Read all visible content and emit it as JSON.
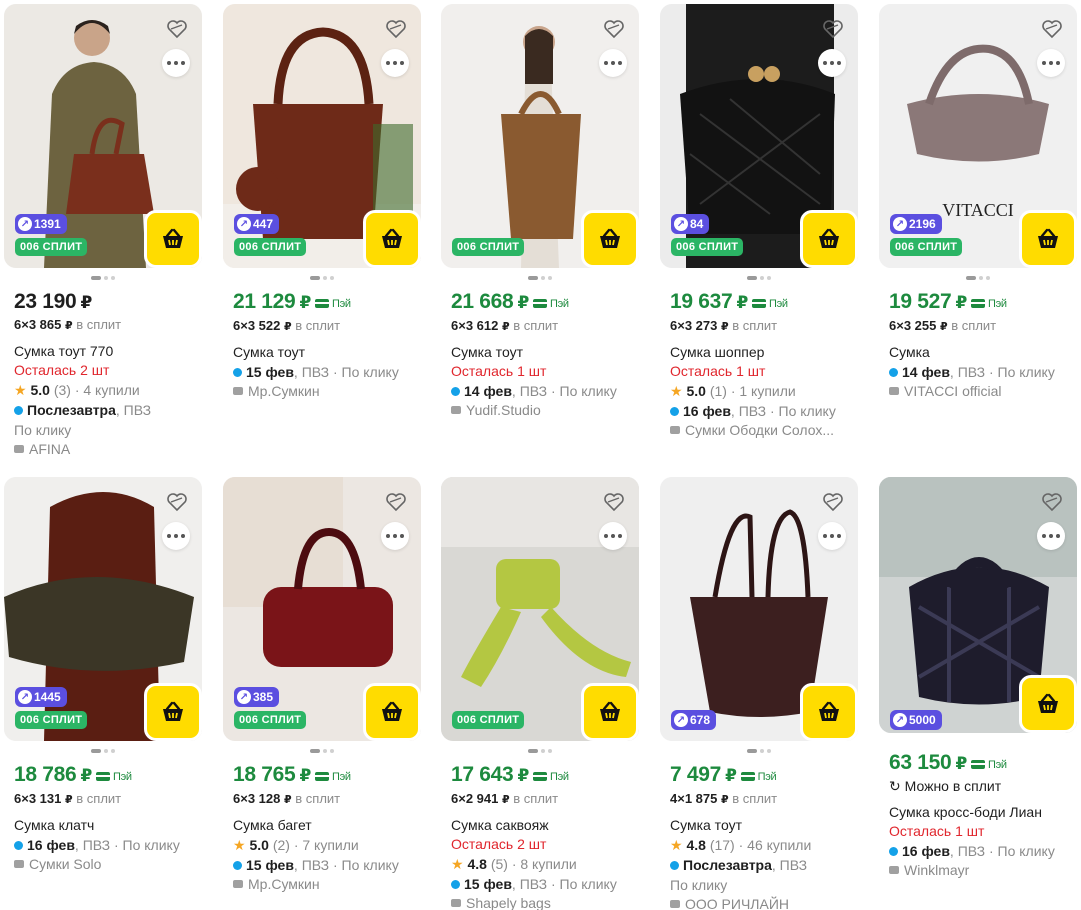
{
  "currency": "₽",
  "split_label": "006 СПЛИТ",
  "pay_label": "Пэй",
  "split_suffix": "в сплит",
  "products": [
    {
      "plus": "1391",
      "price": "23 190",
      "pay": false,
      "split": "6×3 865",
      "title": "Сумка тоут 770",
      "left": "Осталась 2 шт",
      "rating": "5.0",
      "reviews": "(3)",
      "bought": "· 4 купили",
      "delivery_date": "Послезавтра",
      "delivery_rest": ", ПВЗ",
      "delivery_rest2": "По клику",
      "shop": "AFINA"
    },
    {
      "plus": "447",
      "price": "21 129",
      "pay": true,
      "split": "6×3 522",
      "title": "Сумка тоут",
      "delivery_date": "15 фев",
      "delivery_rest": ", ПВЗ · По клику",
      "shop": "Мр.Сумкин"
    },
    {
      "plus": "",
      "price": "21 668",
      "pay": true,
      "split": "6×3 612",
      "title": "Сумка тоут",
      "left": "Осталась 1 шт",
      "delivery_date": "14 фев",
      "delivery_rest": ", ПВЗ · По клику",
      "shop": "Yudif.Studio"
    },
    {
      "plus": "84",
      "price": "19 637",
      "pay": true,
      "split": "6×3 273",
      "title": "Сумка шоппер",
      "left": "Осталась 1 шт",
      "rating": "5.0",
      "reviews": "(1)",
      "bought": "· 1 купили",
      "delivery_date": "16 фев",
      "delivery_rest": ", ПВЗ · По клику",
      "shop": "Сумки Ободки Солох..."
    },
    {
      "plus": "2196",
      "price": "19 527",
      "pay": true,
      "split": "6×3 255",
      "title": "Сумка",
      "delivery_date": "14 фев",
      "delivery_rest": ", ПВЗ · По клику",
      "shop": "VITACCI official",
      "image_text": "VITACCI"
    },
    {
      "plus": "1445",
      "price": "18 786",
      "pay": true,
      "split": "6×3 131",
      "title": "Сумка клатч",
      "delivery_date": "16 фев",
      "delivery_rest": ", ПВЗ · По клику",
      "shop": "Сумки Solo"
    },
    {
      "plus": "385",
      "price": "18 765",
      "pay": true,
      "split": "6×3 128",
      "title": "Сумка багет",
      "rating": "5.0",
      "reviews": "(2)",
      "bought": "· 7 купили",
      "delivery_date": "15 фев",
      "delivery_rest": ", ПВЗ · По клику",
      "shop": "Мр.Сумкин"
    },
    {
      "plus": "",
      "price": "17 643",
      "pay": true,
      "split": "6×2 941",
      "title": "Сумка саквояж",
      "left": "Осталась 2 шт",
      "rating": "4.8",
      "reviews": "(5)",
      "bought": "· 8 купили",
      "delivery_date": "15 фев",
      "delivery_rest": ", ПВЗ · По клику",
      "shop": "Shapely bags"
    },
    {
      "plus": "678",
      "price": "7 497",
      "pay": true,
      "split": "4×1 875",
      "title": "Сумка тоут",
      "rating": "4.8",
      "reviews": "(17)",
      "bought": "· 46 купили",
      "delivery_date": "Послезавтра",
      "delivery_rest": ", ПВЗ",
      "delivery_rest2": "По клику",
      "shop": "ООО РИЧЛАЙН"
    },
    {
      "plus": "5000",
      "price": "63 150",
      "pay": true,
      "split_only": "Можно в сплит",
      "title": "Сумка кросс-боди Лиан",
      "left": "Осталась 1 шт",
      "delivery_date": "16 фев",
      "delivery_rest": ", ПВЗ · По клику",
      "shop": "Winklmayr"
    }
  ]
}
